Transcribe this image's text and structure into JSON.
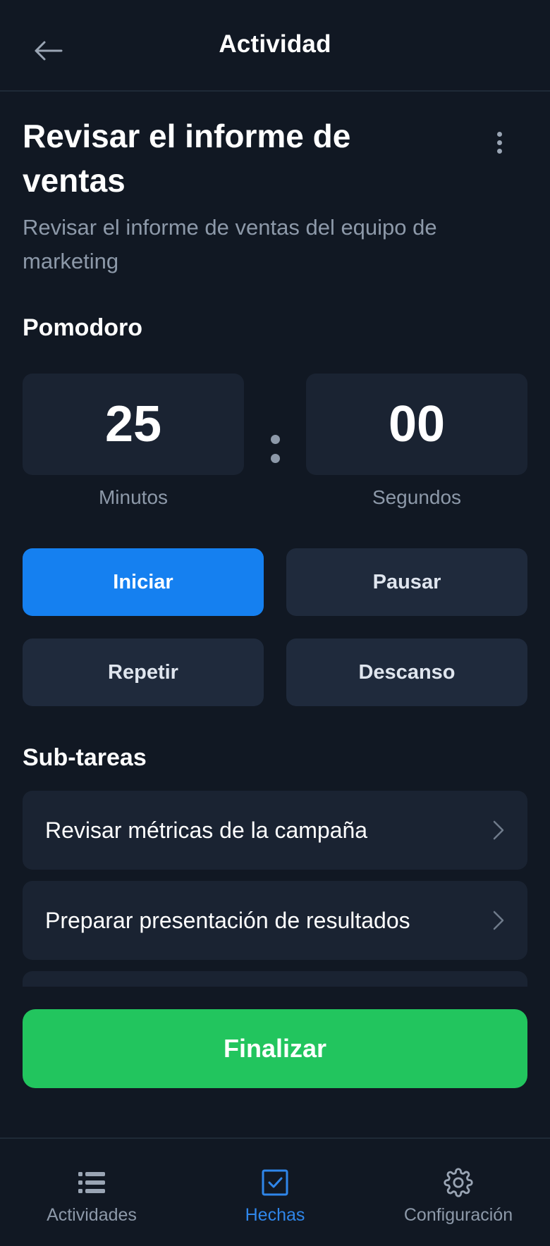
{
  "header": {
    "title": "Actividad",
    "back_icon": "arrow-left-icon"
  },
  "task": {
    "title": "Revisar el informe de ventas",
    "description": "Revisar el informe de ventas del equipo de marketing",
    "more_icon": "more-vertical-icon"
  },
  "pomodoro": {
    "section_title": "Pomodoro",
    "minutes": "25",
    "seconds": "00",
    "minutes_label": "Minutos",
    "seconds_label": "Segundos"
  },
  "controls": {
    "start": "Iniciar",
    "pause": "Pausar",
    "repeat": "Repetir",
    "break": "Descanso"
  },
  "subtasks": {
    "section_title": "Sub-tareas",
    "items": [
      {
        "label": "Revisar métricas de la campaña"
      },
      {
        "label": "Preparar presentación de resultados"
      },
      {
        "label": ""
      }
    ]
  },
  "finish": {
    "label": "Finalizar"
  },
  "nav": {
    "items": [
      {
        "label": "Actividades",
        "icon": "list-icon",
        "active": false
      },
      {
        "label": "Hechas",
        "icon": "checkbox-icon",
        "active": true
      },
      {
        "label": "Configuración",
        "icon": "gear-icon",
        "active": false
      }
    ]
  },
  "colors": {
    "background": "#111823",
    "card": "#1a2332",
    "primary": "#1580f0",
    "success": "#22c55e",
    "active_nav": "#2f86ea"
  }
}
